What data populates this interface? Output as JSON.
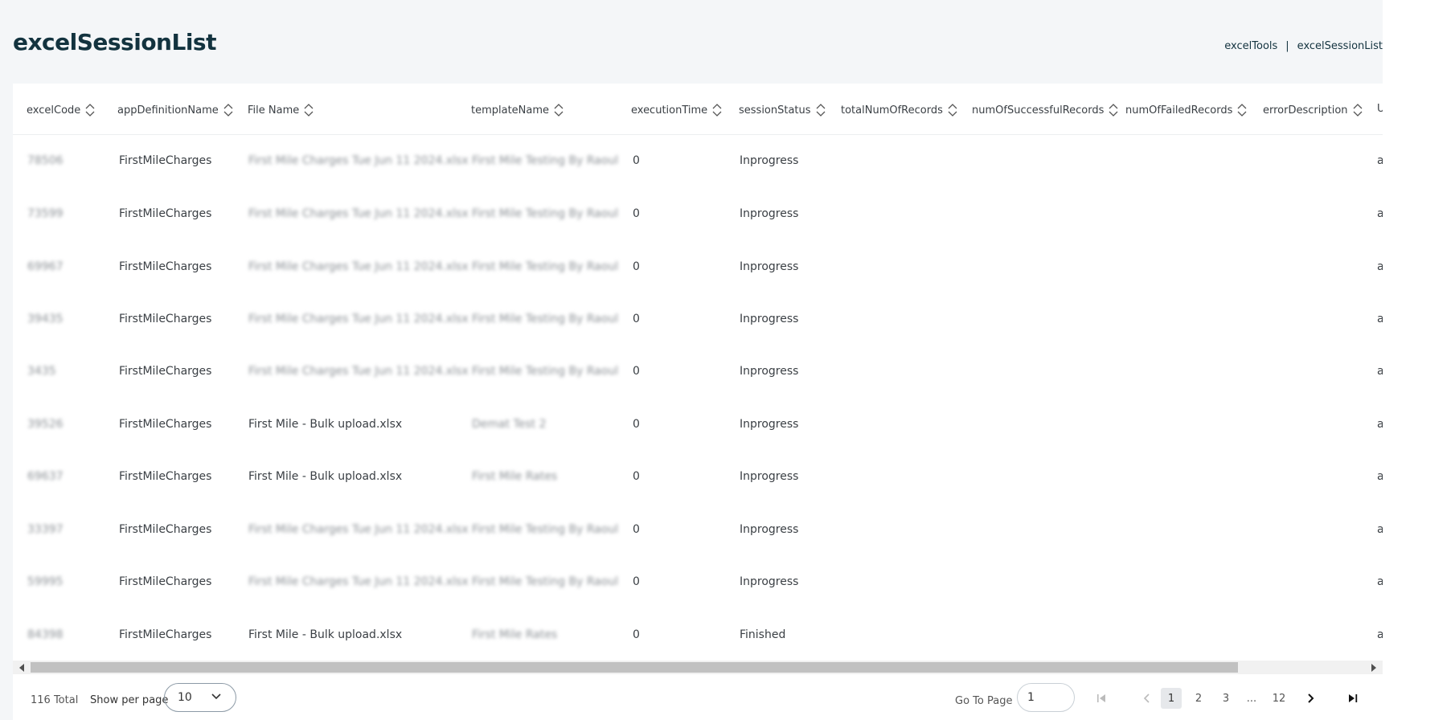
{
  "page": {
    "title": "excelSessionList"
  },
  "breadcrumb": {
    "items": [
      "excelTools",
      "excelSessionList"
    ],
    "separator": "|"
  },
  "table": {
    "columns": [
      "excelCode",
      "appDefinitionName",
      "File Name",
      "templateName",
      "executionTime",
      "sessionStatus",
      "totalNumOfRecords",
      "numOfSuccessfulRecords",
      "numOfFailedRecords",
      "errorDescription",
      "U"
    ],
    "rows": [
      {
        "code": "78506",
        "app": "FirstMileCharges",
        "file": "First Mile Charges Tue Jun 11 2024.xlsx",
        "template": "First Mile Testing By Raoul",
        "time": "0",
        "status": "Inprogress",
        "extra": "a"
      },
      {
        "code": "73599",
        "app": "FirstMileCharges",
        "file": "First Mile Charges Tue Jun 11 2024.xlsx",
        "template": "First Mile Testing By Raoul",
        "time": "0",
        "status": "Inprogress",
        "extra": "a"
      },
      {
        "code": "69967",
        "app": "FirstMileCharges",
        "file": "First Mile Charges Tue Jun 11 2024.xlsx",
        "template": "First Mile Testing By Raoul",
        "time": "0",
        "status": "Inprogress",
        "extra": "a"
      },
      {
        "code": "39435",
        "app": "FirstMileCharges",
        "file": "First Mile Charges Tue Jun 11 2024.xlsx",
        "template": "First Mile Testing By Raoul",
        "time": "0",
        "status": "Inprogress",
        "extra": "a"
      },
      {
        "code": "3435",
        "app": "FirstMileCharges",
        "file": "First Mile Charges Tue Jun 11 2024.xlsx",
        "template": "First Mile Testing By Raoul",
        "time": "0",
        "status": "Inprogress",
        "extra": "a"
      },
      {
        "code": "39526",
        "app": "FirstMileCharges",
        "file": "First Mile - Bulk upload.xlsx",
        "template": "Demat Test 2",
        "time": "0",
        "status": "Inprogress",
        "extra": "a"
      },
      {
        "code": "69637",
        "app": "FirstMileCharges",
        "file": "First Mile - Bulk upload.xlsx",
        "template": "First Mile Rates",
        "time": "0",
        "status": "Inprogress",
        "extra": "a"
      },
      {
        "code": "33397",
        "app": "FirstMileCharges",
        "file": "First Mile Charges Tue Jun 11 2024.xlsx",
        "template": "First Mile Testing By Raoul",
        "time": "0",
        "status": "Inprogress",
        "extra": "a"
      },
      {
        "code": "59995",
        "app": "FirstMileCharges",
        "file": "First Mile Charges Tue Jun 11 2024.xlsx",
        "template": "First Mile Testing By Raoul",
        "time": "0",
        "status": "Inprogress",
        "extra": "a"
      },
      {
        "code": "84398",
        "app": "FirstMileCharges",
        "file": "First Mile - Bulk upload.xlsx",
        "template": "First Mile Rates",
        "time": "0",
        "status": "Finished",
        "extra": "a"
      }
    ]
  },
  "footer": {
    "total": "116 Total",
    "per_page_label": "Show per page",
    "per_page_value": "10",
    "goto_label": "Go To Page",
    "goto_value": "1",
    "pages": [
      "1",
      "2",
      "3",
      "...",
      "12"
    ],
    "current_page": "1"
  },
  "icons": {
    "sort": "sort-icon",
    "first": "first-page-icon",
    "prev": "prev-page-icon",
    "next": "next-page-icon",
    "last": "last-page-icon",
    "chevron": "chevron-down-icon"
  },
  "colors": {
    "title": "#13333f",
    "text": "#3a3f44",
    "background": "#f4f6f8"
  }
}
